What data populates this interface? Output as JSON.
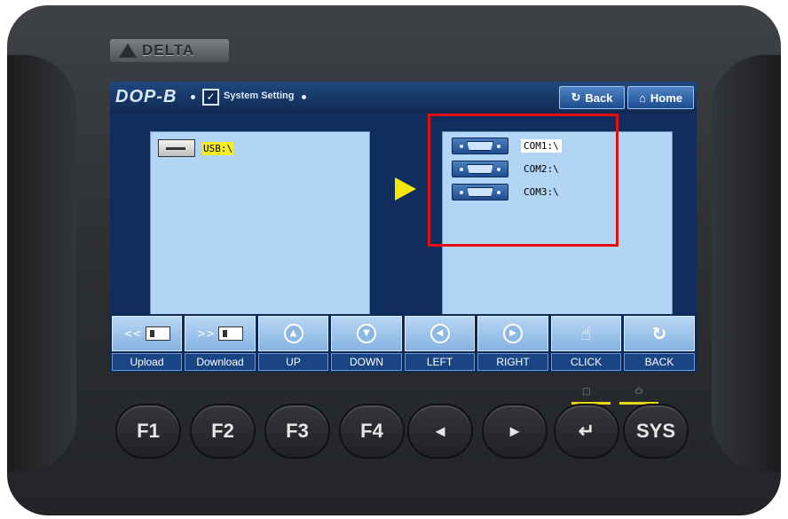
{
  "device": {
    "brand": "DELTA",
    "model": "DOP-B"
  },
  "screen": {
    "header": {
      "title": "System Setting",
      "back_label": "Back",
      "home_label": "Home"
    },
    "left_pane": {
      "items": [
        {
          "label": "USB:\\",
          "icon": "usb-drive-icon",
          "selected": true
        }
      ]
    },
    "right_pane": {
      "items": [
        {
          "label": "COM1:\\",
          "icon": "serial-port-icon",
          "selected": true
        },
        {
          "label": "COM2:\\",
          "icon": "serial-port-icon",
          "selected": false
        },
        {
          "label": "COM3:\\",
          "icon": "serial-port-icon",
          "selected": false
        }
      ]
    },
    "function_bar": [
      {
        "label": "Upload",
        "icon": "upload-icon"
      },
      {
        "label": "Download",
        "icon": "download-icon"
      },
      {
        "label": "UP",
        "icon": "up-icon"
      },
      {
        "label": "DOWN",
        "icon": "down-icon"
      },
      {
        "label": "LEFT",
        "icon": "left-icon"
      },
      {
        "label": "RIGHT",
        "icon": "right-icon"
      },
      {
        "label": "CLICK",
        "icon": "hand-pointer-icon"
      },
      {
        "label": "BACK",
        "icon": "back-icon"
      }
    ]
  },
  "hardware_keys": [
    {
      "label": "F1"
    },
    {
      "label": "F2"
    },
    {
      "label": "F3"
    },
    {
      "label": "F4"
    },
    {
      "label": "◄"
    },
    {
      "label": "►"
    },
    {
      "label": "↵"
    },
    {
      "label": "SYS"
    }
  ],
  "colors": {
    "highlight": "#e30d12",
    "selection": "#f7ef22",
    "arrow": "#f5e70c"
  }
}
